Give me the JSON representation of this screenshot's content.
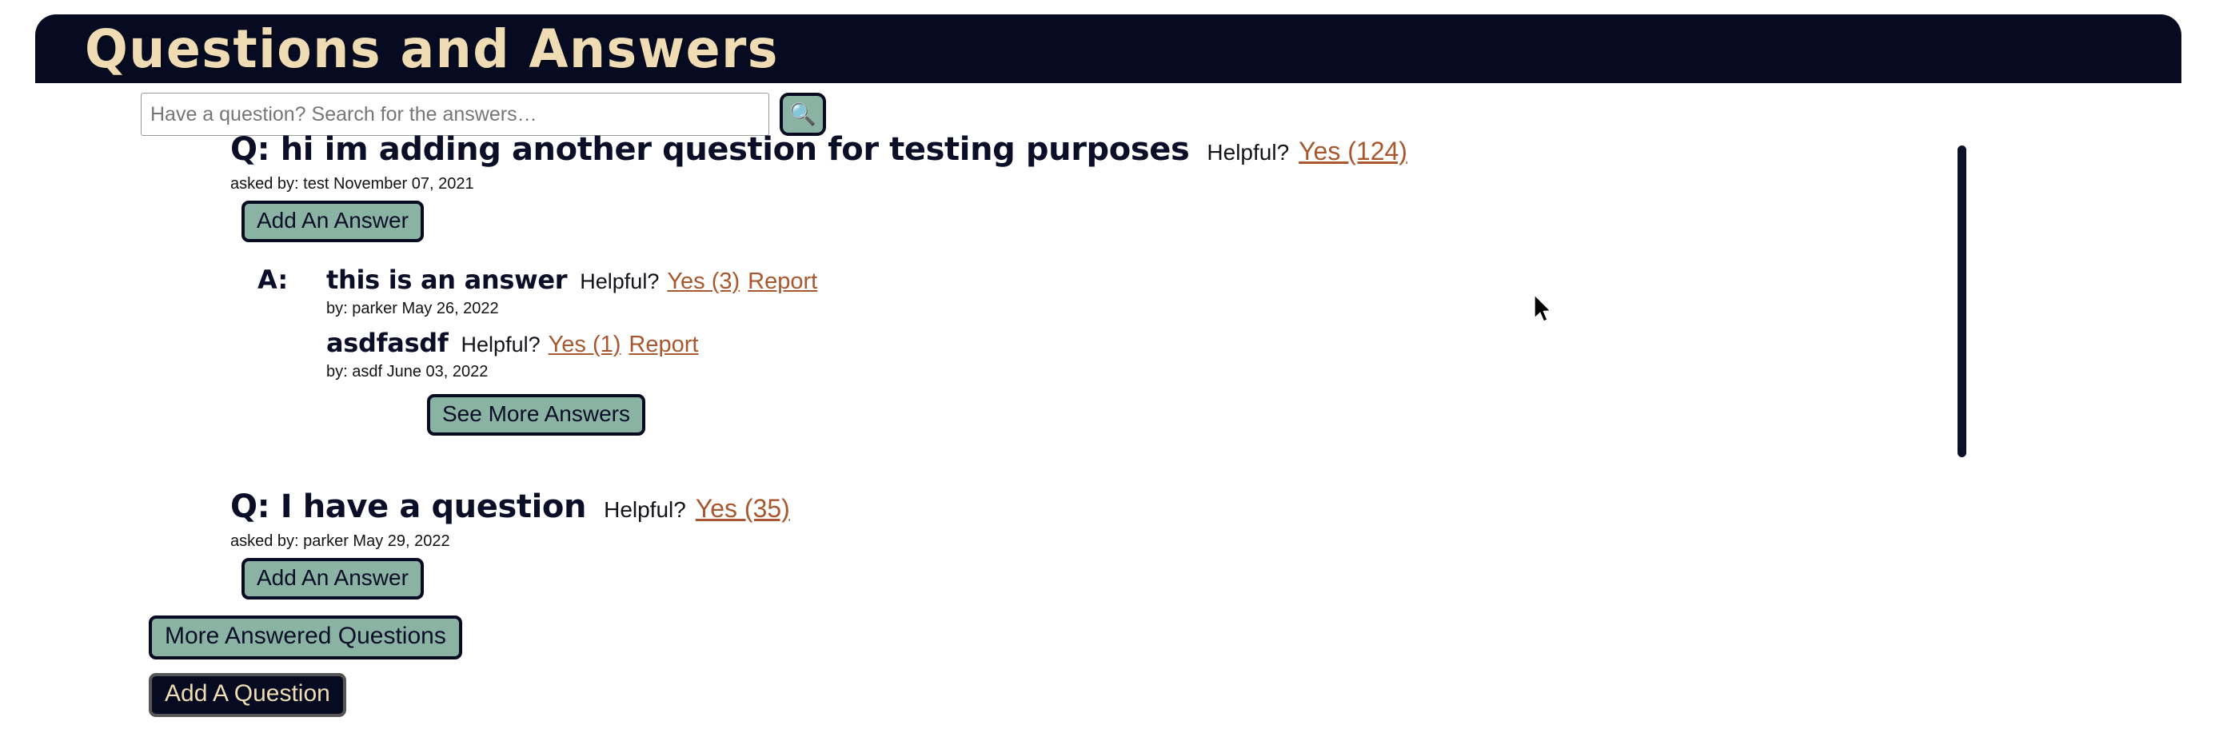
{
  "header": {
    "title": "Questions and Answers"
  },
  "search": {
    "placeholder": "Have a question? Search for the answers…",
    "value": "",
    "button_icon": "search-icon",
    "button_glyph": "🔍"
  },
  "labels": {
    "helpful": "Helpful?",
    "report": "Report",
    "answer_prefix": "A:",
    "add_an_answer": "Add An Answer",
    "see_more_answers": "See More Answers"
  },
  "questions": [
    {
      "text": "Q: hi im adding another question for testing purposes",
      "helpful_label": "Helpful?",
      "helpful_link": "Yes (124)",
      "meta": "asked by: test November 07, 2021",
      "add_answer_label": "Add An Answer",
      "answer_prefix": "A:",
      "answers": [
        {
          "text": "this is an answer",
          "helpful_label": "Helpful?",
          "helpful_link": "Yes (3)",
          "report_link": "Report",
          "meta": "by: parker May 26, 2022"
        },
        {
          "text": "asdfasdf",
          "helpful_label": "Helpful?",
          "helpful_link": "Yes (1)",
          "report_link": "Report",
          "meta": "by: asdf June 03, 2022"
        }
      ],
      "see_more_label": "See More Answers"
    },
    {
      "text": "Q: I have a question",
      "helpful_label": "Helpful?",
      "helpful_link": "Yes (35)",
      "meta": "asked by: parker May 29, 2022",
      "add_answer_label": "Add An Answer",
      "answers": []
    }
  ],
  "footer": {
    "more_answered_questions": "More Answered Questions",
    "add_a_question": "Add A Question"
  },
  "colors": {
    "header_bg": "#060B21",
    "header_text": "#F0DCB4",
    "button_bg": "#8AB3A3",
    "button_border": "#060B21",
    "link": "#A8572F",
    "body_text": "#0A0E27",
    "page_bg": "#FFFFFF",
    "scrollbar_thumb": "#0B1228"
  }
}
